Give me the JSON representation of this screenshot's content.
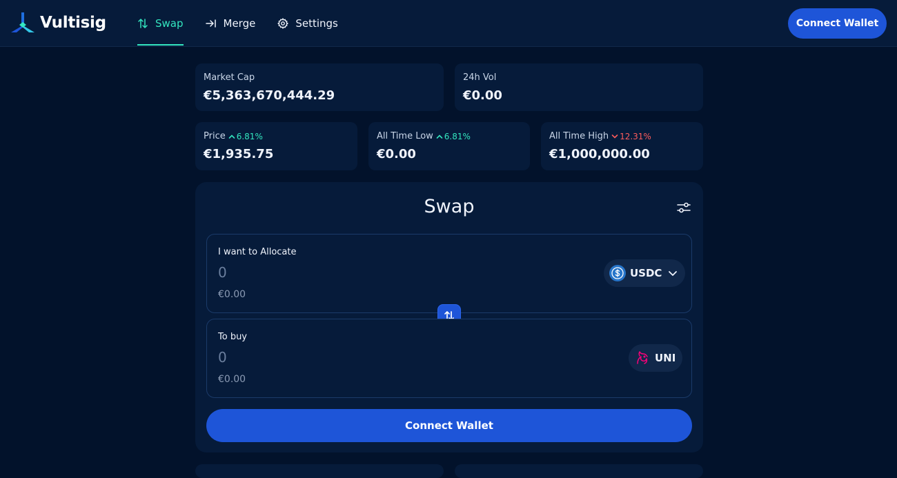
{
  "header": {
    "brand": "Vultisig",
    "nav": [
      {
        "label": "Swap",
        "icon": "swap-arrows-icon",
        "active": true
      },
      {
        "label": "Merge",
        "icon": "merge-arrow-icon",
        "active": false
      },
      {
        "label": "Settings",
        "icon": "gear-icon",
        "active": false
      }
    ],
    "connect_label": "Connect Wallet"
  },
  "stats": {
    "market_cap": {
      "label": "Market Cap",
      "value": "€5,363,670,444.29"
    },
    "volume_24h": {
      "label": "24h Vol",
      "value": "€0.00"
    },
    "price": {
      "label": "Price",
      "change": "6.81%",
      "direction": "up",
      "value": "€1,935.75"
    },
    "all_time_low": {
      "label": "All Time Low",
      "change": "6.81%",
      "direction": "up",
      "value": "€0.00"
    },
    "all_time_high": {
      "label": "All Time High",
      "change": "12.31%",
      "direction": "down",
      "value": "€1,000,000.00"
    }
  },
  "swap": {
    "title": "Swap",
    "from": {
      "label": "I want to Allocate",
      "placeholder": "0",
      "fiat": "€0.00",
      "token": "USDC",
      "token_icon": "usdc-icon"
    },
    "to": {
      "label": "To buy",
      "placeholder": "0",
      "fiat": "€0.00",
      "token": "UNI",
      "token_icon": "uni-icon"
    },
    "connect_label": "Connect Wallet"
  },
  "colors": {
    "background": "#02122b",
    "panel": "#061b3a",
    "accent": "#33e6bf",
    "primary": "#1e55d8",
    "negative": "#ff5c5c"
  }
}
